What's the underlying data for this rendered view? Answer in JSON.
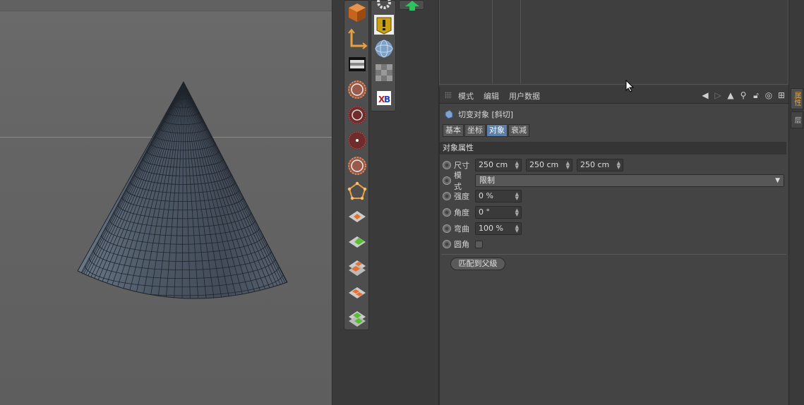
{
  "attribute_manager": {
    "menu": [
      "模式",
      "编辑",
      "用户数据"
    ],
    "object_title": "切变对象 [斜切]",
    "tabs": [
      {
        "label": "基本",
        "active": false
      },
      {
        "label": "坐标",
        "active": false
      },
      {
        "label": "对象",
        "active": true
      },
      {
        "label": "衰减",
        "active": false
      }
    ],
    "section_title": "对象属性",
    "properties": {
      "size_label": "尺寸",
      "size_x": "250 cm",
      "size_y": "250 cm",
      "size_z": "250 cm",
      "mode_label": "模式",
      "mode_value": "限制",
      "strength_label": "强度",
      "strength_value": "0 %",
      "angle_label": "角度",
      "angle_value": "0 °",
      "curvature_label": "弯曲",
      "curvature_value": "100 %",
      "fillet_label": "圆角"
    },
    "match_button": "匹配到父级"
  },
  "right_rail": {
    "tab1": "属性",
    "tab2": "层"
  },
  "colors": {
    "active_tab": "#5b7fa6",
    "accent_orange": "#f0a030"
  }
}
